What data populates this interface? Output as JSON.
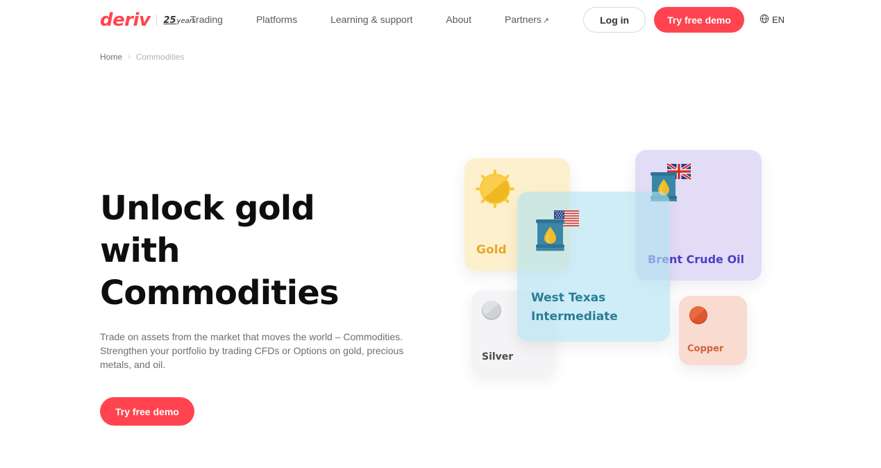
{
  "header": {
    "logo_text": "deriv",
    "anniversary_number": "25",
    "anniversary_word": "years",
    "nav": [
      {
        "label": "Trading",
        "external": false
      },
      {
        "label": "Platforms",
        "external": false
      },
      {
        "label": "Learning & support",
        "external": false
      },
      {
        "label": "About",
        "external": false
      },
      {
        "label": "Partners",
        "external": true,
        "external_glyph": "↗"
      }
    ],
    "login_label": "Log in",
    "demo_label": "Try free demo",
    "language": "EN",
    "globe_icon": "globe-icon"
  },
  "breadcrumb": {
    "home": "Home",
    "separator": "›",
    "current": "Commodities"
  },
  "hero": {
    "title": "Unlock gold with Commodities",
    "subtitle": "Trade on assets from the market that moves the world – Commodities. Strengthen your portfolio by trading CFDs or Options on gold, precious metals, and oil.",
    "cta_label": "Try free demo"
  },
  "cards": {
    "gold": {
      "label": "Gold",
      "icon": "gold-coin-icon",
      "bg": "#fdf0cd",
      "text_color": "#e8a82d"
    },
    "silver": {
      "label": "Silver",
      "icon": "silver-coin-icon",
      "bg": "#f4f4f6",
      "text_color": "#4a4a4a"
    },
    "brent": {
      "label": "Brent Crude Oil",
      "icon": "oil-barrel-uk-flag-icon",
      "bg": "#e3dcf7",
      "text_color": "#4c3fc4"
    },
    "wti": {
      "label": "West Texas Intermediate",
      "icon": "oil-barrel-us-flag-icon",
      "bg": "#b0e2f0",
      "text_color": "#2a7d96"
    },
    "copper": {
      "label": "Copper",
      "icon": "copper-coin-icon",
      "bg": "#fadbd0",
      "text_color": "#d4623a"
    }
  },
  "colors": {
    "brand_red": "#ff444f",
    "text_dark": "#0e0e0e",
    "text_muted": "#6e6e6e"
  }
}
